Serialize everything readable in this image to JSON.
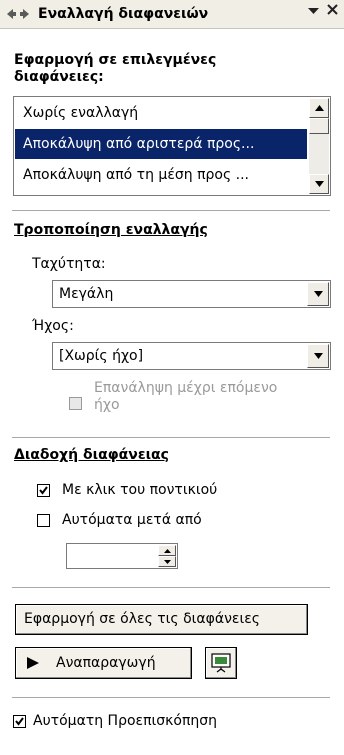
{
  "titlebar": {
    "back_icon": "back-arrow-icon",
    "forward_icon": "forward-arrow-icon",
    "title": "Εναλλαγή διαφανειών",
    "menu_icon": "dropdown-triangle-icon",
    "close_icon": "close-icon"
  },
  "apply_section": {
    "heading_line1": "Εφαρμογή σε επιλεγμένες",
    "heading_line2": "διαφάνειες:",
    "items": [
      "Χωρίς εναλλαγή",
      "Αποκάλυψη από αριστερά προς...",
      "Αποκάλυψη από τη μέση προς ..."
    ],
    "selected_index": 1
  },
  "modify_section": {
    "heading": "Τροποποίηση εναλλαγής",
    "speed_label": "Ταχύτητα:",
    "speed_value": "Μεγάλη",
    "sound_label": "Ήχος:",
    "sound_value": "[Χωρίς ήχο]",
    "loop_label_line1": "Επανάληψη μέχρι επόμενο",
    "loop_label_line2": "ήχο",
    "loop_checked": false,
    "loop_enabled": false
  },
  "advance_section": {
    "heading": "Διαδοχή διαφάνειας",
    "on_click_label": "Με κλικ του ποντικιού",
    "on_click_checked": true,
    "auto_label": "Αυτόματα μετά από",
    "auto_checked": false,
    "auto_value": ""
  },
  "actions": {
    "apply_all_label": "Εφαρμογή σε όλες τις διαφάνειες",
    "play_label": "Αναπαραγωγή",
    "play_icon": "play-triangle-icon",
    "slideshow_icon": "slide-show-icon"
  },
  "footer": {
    "autopreview_label": "Αυτόματη Προεπισκόπηση",
    "autopreview_checked": true
  },
  "colors": {
    "selection": "#0a246a",
    "titlebar_bg": "#f1eee6",
    "button_face": "#efede6",
    "disabled_text": "#9a9a9a"
  }
}
